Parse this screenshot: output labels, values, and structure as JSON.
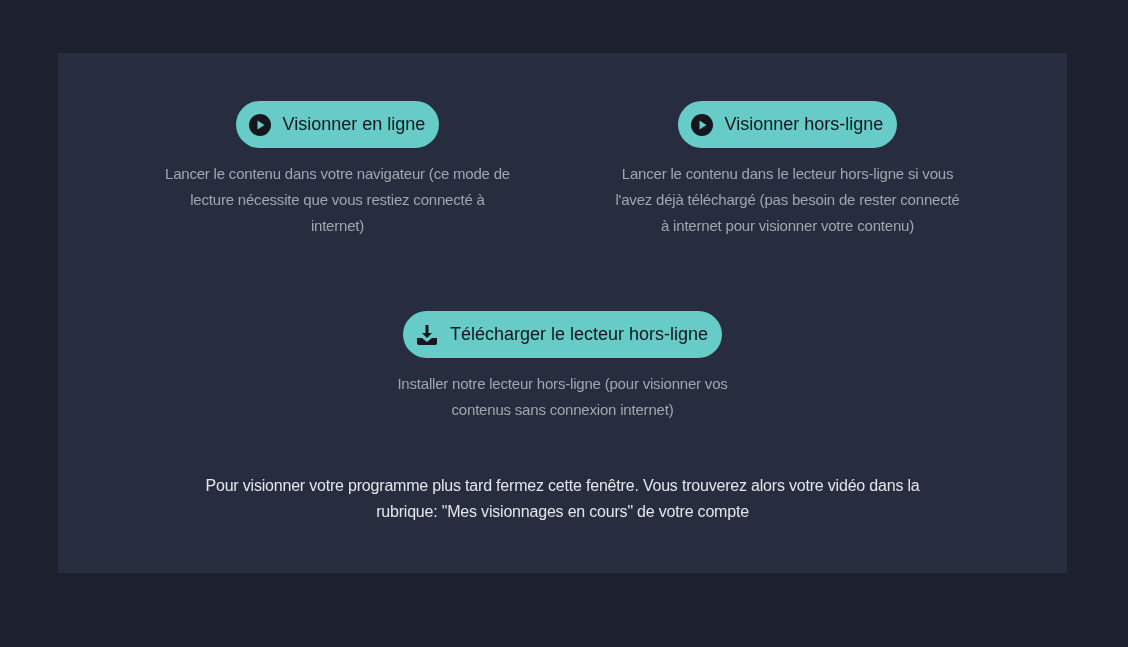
{
  "options": [
    {
      "kind": "play",
      "label": "Visionner en ligne",
      "description": "Lancer le contenu dans votre navigateur (ce mode de lecture nécessite que vous restiez connecté à internet)"
    },
    {
      "kind": "play",
      "label": "Visionner hors-ligne",
      "description": "Lancer le contenu dans le lecteur hors-ligne si vous l'avez déjà téléchargé (pas besoin de rester connecté à internet pour visionner votre contenu)"
    }
  ],
  "installer": {
    "kind": "download",
    "label": "Télécharger le lecteur hors-ligne",
    "description": "Installer notre lecteur hors-ligne (pour visionner vos contenus sans connexion internet)"
  },
  "note": "Pour visionner votre programme plus tard fermez cette fenêtre. Vous trouverez alors votre vidéo dans la rubrique: \"Mes visionnages en cours\" de votre compte"
}
